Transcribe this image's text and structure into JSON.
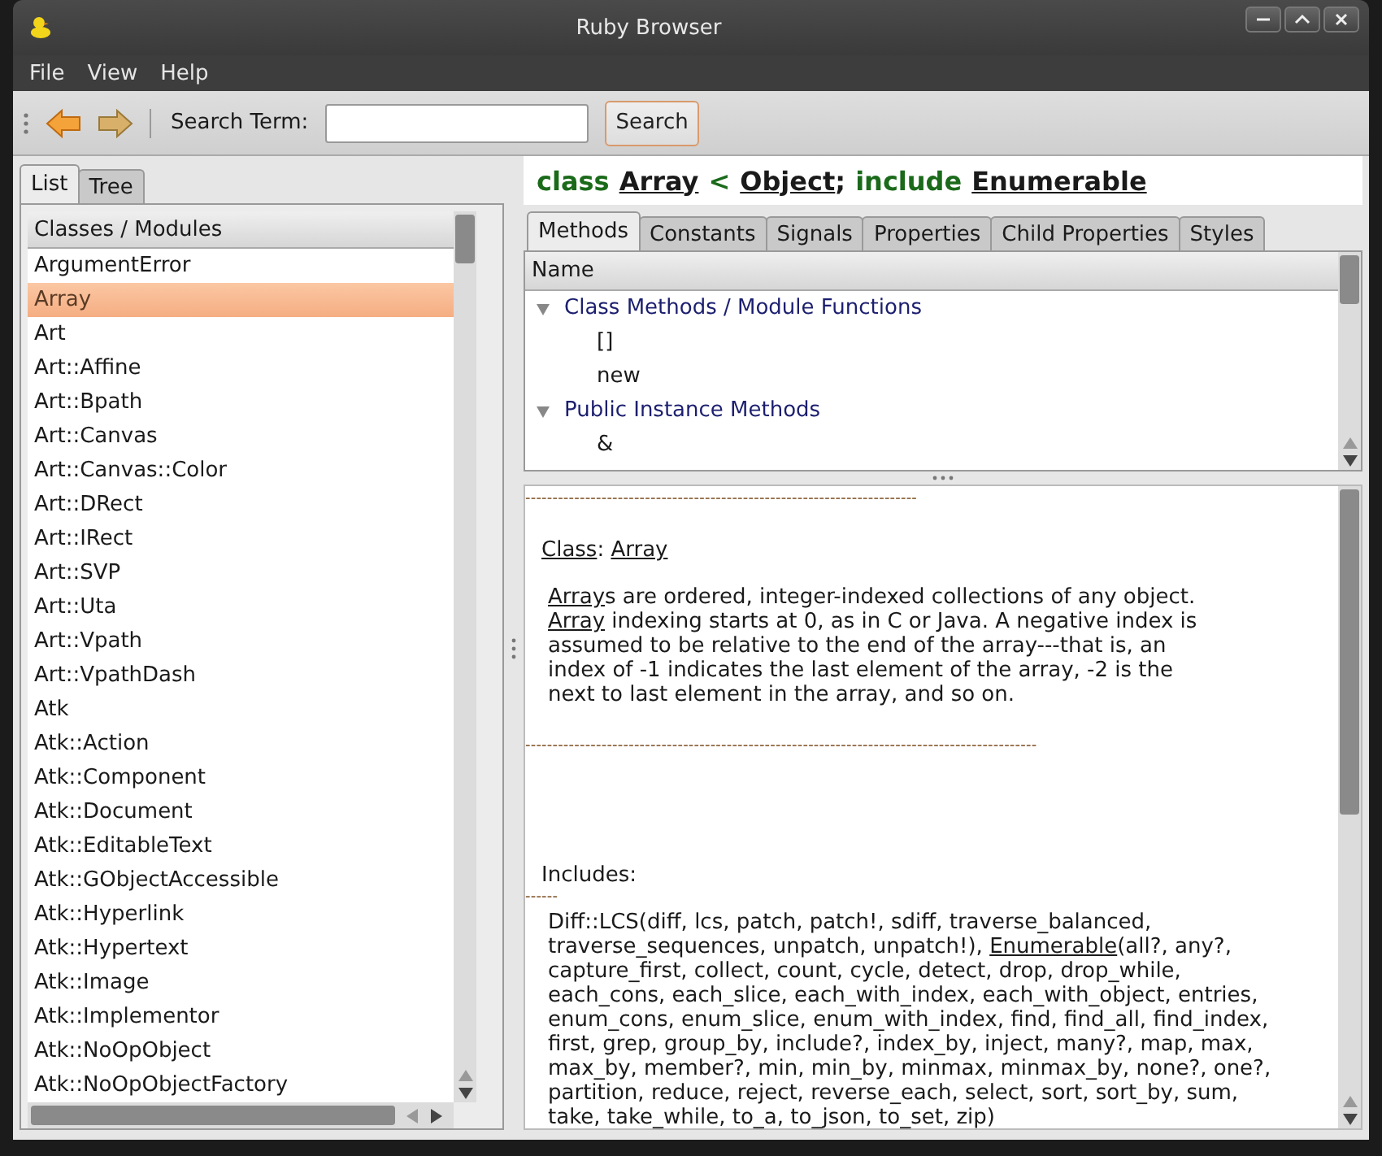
{
  "window": {
    "title": "Ruby Browser"
  },
  "menu": [
    "File",
    "View",
    "Help"
  ],
  "toolbar": {
    "search_label": "Search Term:",
    "search_button": "Search"
  },
  "left_tabs": [
    {
      "label": "List",
      "selected": true
    },
    {
      "label": "Tree",
      "selected": false
    }
  ],
  "class_list": {
    "header": "Classes / Modules",
    "items": [
      {
        "name": "ArgumentError",
        "selected": false
      },
      {
        "name": "Array",
        "selected": true
      },
      {
        "name": "Art",
        "selected": false
      },
      {
        "name": "Art::Affine",
        "selected": false
      },
      {
        "name": "Art::Bpath",
        "selected": false
      },
      {
        "name": "Art::Canvas",
        "selected": false
      },
      {
        "name": "Art::Canvas::Color",
        "selected": false
      },
      {
        "name": "Art::DRect",
        "selected": false
      },
      {
        "name": "Art::IRect",
        "selected": false
      },
      {
        "name": "Art::SVP",
        "selected": false
      },
      {
        "name": "Art::Uta",
        "selected": false
      },
      {
        "name": "Art::Vpath",
        "selected": false
      },
      {
        "name": "Art::VpathDash",
        "selected": false
      },
      {
        "name": "Atk",
        "selected": false
      },
      {
        "name": "Atk::Action",
        "selected": false
      },
      {
        "name": "Atk::Component",
        "selected": false
      },
      {
        "name": "Atk::Document",
        "selected": false
      },
      {
        "name": "Atk::EditableText",
        "selected": false
      },
      {
        "name": "Atk::GObjectAccessible",
        "selected": false
      },
      {
        "name": "Atk::Hyperlink",
        "selected": false
      },
      {
        "name": "Atk::Hypertext",
        "selected": false
      },
      {
        "name": "Atk::Image",
        "selected": false
      },
      {
        "name": "Atk::Implementor",
        "selected": false
      },
      {
        "name": "Atk::NoOpObject",
        "selected": false
      },
      {
        "name": "Atk::NoOpObjectFactory",
        "selected": false
      }
    ]
  },
  "heading": [
    {
      "kind": "keyword",
      "text": "class"
    },
    {
      "kind": "link",
      "text": "Array"
    },
    {
      "kind": "keyword",
      "text": "<"
    },
    {
      "kind": "link",
      "text": "Object"
    },
    {
      "kind": "punct",
      "text": ";"
    },
    {
      "kind": "keyword",
      "text": "include"
    },
    {
      "kind": "link",
      "text": "Enumerable"
    }
  ],
  "right_tabs": [
    {
      "label": "Methods",
      "selected": true
    },
    {
      "label": "Constants",
      "selected": false
    },
    {
      "label": "Signals",
      "selected": false
    },
    {
      "label": "Properties",
      "selected": false
    },
    {
      "label": "Child Properties",
      "selected": false
    },
    {
      "label": "Styles",
      "selected": false
    }
  ],
  "methods": {
    "header": "Name",
    "groups": [
      {
        "label": "Class Methods / Module Functions",
        "expanded": true,
        "children": [
          "[]",
          "new"
        ]
      },
      {
        "label": "Public Instance Methods",
        "expanded": true,
        "children": [
          "&"
        ]
      }
    ]
  },
  "doc": {
    "rule_top": "------------------------------------------------------------------------",
    "class_line": [
      {
        "kind": "link",
        "text": "Class"
      },
      {
        "kind": "text",
        "text": ": "
      },
      {
        "kind": "link",
        "text": "Array"
      }
    ],
    "description": [
      {
        "kind": "link",
        "text": "Array"
      },
      {
        "kind": "text",
        "text": "s are ordered, integer-indexed collections of any object. "
      },
      {
        "kind": "link",
        "text": "Array"
      },
      {
        "kind": "text",
        "text": " indexing starts at 0, as in C or Java. A negative index is assumed to be relative to the end of the array---that is, an index of -1 indicates the last element of the array, -2 is the next to last element in the array, and so on."
      }
    ],
    "rule_bottom": "----------------------------------------------------------------------------------------------",
    "includes_label": "Includes:",
    "includes_rule": "------",
    "includes": [
      {
        "kind": "text",
        "text": "Diff::LCS(diff, lcs, patch, patch!, sdiff, traverse_balanced, traverse_sequences, unpatch, unpatch!), "
      },
      {
        "kind": "link",
        "text": "Enumerable"
      },
      {
        "kind": "text",
        "text": "(all?, any?, capture_first, collect, count, cycle, detect, drop, drop_while, each_cons, each_slice, each_with_index, each_with_object, entries, enum_cons, enum_slice, enum_with_index, find, find_all, find_index, first, grep, group_by, include?, index_by, inject, many?, map, max, max_by, member?, min, min_by, minmax, minmax_by, none?, one?, partition, reduce, reject, reverse_each, select, sort, sort_by, sum, take, take_while, to_a, to_json, to_set, zip)"
      }
    ]
  }
}
